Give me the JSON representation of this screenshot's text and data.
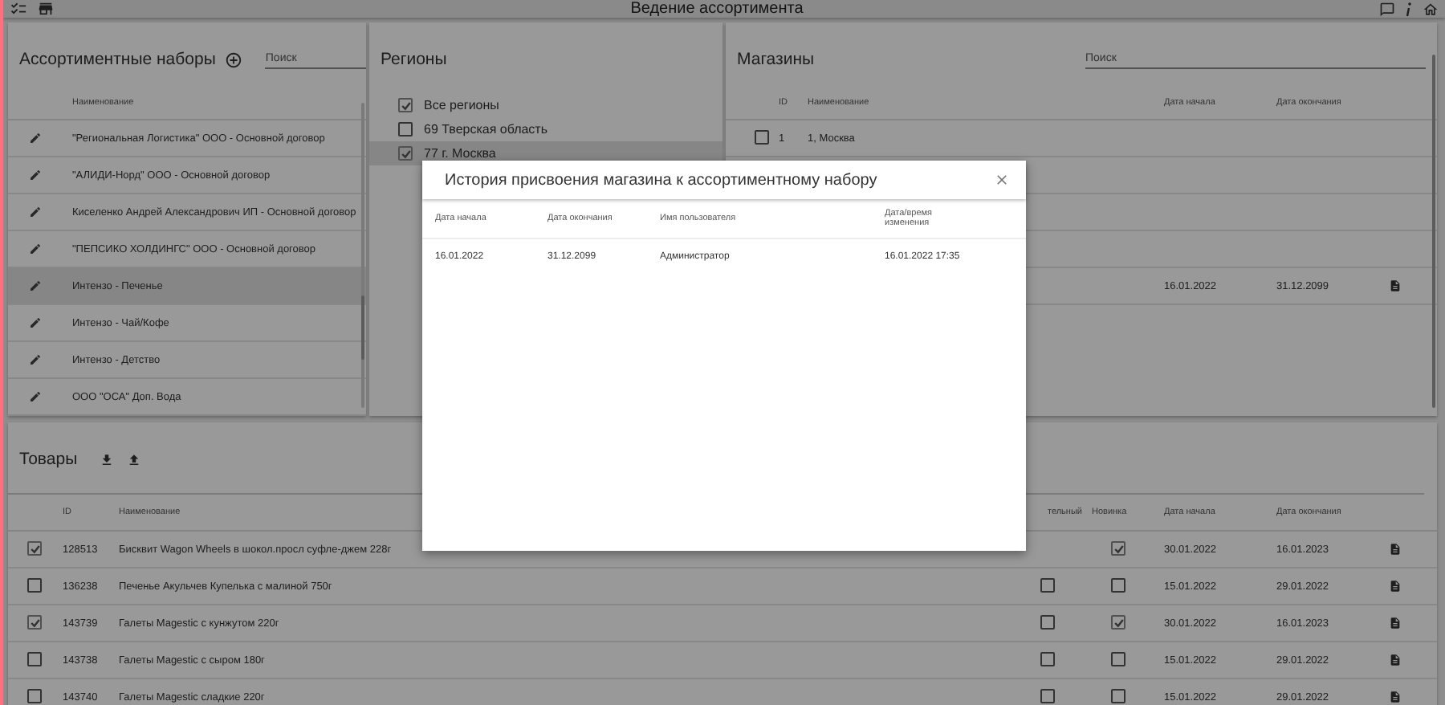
{
  "window": {
    "title": "Ведение ассортимента"
  },
  "assortment_sets": {
    "title": "Ассортиментные наборы",
    "search": {
      "placeholder": "Поиск"
    },
    "columns": [
      "Наименование"
    ],
    "rows": [
      {
        "name": "\"Региональная Логистика\" ООО - Основной договор",
        "selected": false
      },
      {
        "name": "\"АЛИДИ-Норд\" ООО - Основной договор",
        "selected": false
      },
      {
        "name": "Киселенко Андрей Александрович ИП - Основной договор",
        "selected": false
      },
      {
        "name": "\"ПЕПСИКО ХОЛДИНГС\" ООО - Основной договор",
        "selected": false
      },
      {
        "name": "Интензо - Печенье",
        "selected": true
      },
      {
        "name": "Интензо - Чай/Кофе",
        "selected": false
      },
      {
        "name": "Интензо - Детство",
        "selected": false
      },
      {
        "name": "ООО \"ОСА\" Доп. Вода",
        "selected": false
      }
    ]
  },
  "regions": {
    "title": "Регионы",
    "items": [
      {
        "label": "Все регионы",
        "checked": true,
        "selected": false
      },
      {
        "label": "69 Тверская область",
        "checked": false,
        "selected": false
      },
      {
        "label": "77 г. Москва",
        "checked": true,
        "selected": true
      }
    ]
  },
  "stores": {
    "title": "Магазины",
    "search": {
      "placeholder": "Поиск"
    },
    "columns": [
      "ID",
      "Наименование",
      "Дата начала",
      "Дата окончания"
    ],
    "rows": [
      {
        "checked": false,
        "id": "1",
        "name": "1, Москва"
      },
      {},
      {},
      {},
      {
        "start": "16.01.2022",
        "end": "31.12.2099",
        "history": true
      }
    ]
  },
  "goods": {
    "title": "Товары",
    "columns": [
      "ID",
      "Наименование",
      "тельный",
      "Новинка",
      "Дата начала",
      "Дата окончания"
    ],
    "rows": [
      {
        "checked": true,
        "id": "128513",
        "name": "Бисквит Wagon Wheels в шокол.просл суфле-джем 228г",
        "new": true,
        "start": "30.01.2022",
        "end": "16.01.2023"
      },
      {
        "checked": false,
        "id": "136238",
        "name": "Печенье Акульчев Купелька с малиной 750г",
        "flag": false,
        "new": false,
        "start": "15.01.2022",
        "end": "29.01.2022"
      },
      {
        "checked": true,
        "id": "143739",
        "name": "Галеты Magestic с кунжутом 220г",
        "flag": false,
        "new": true,
        "start": "30.01.2022",
        "end": "16.01.2023"
      },
      {
        "checked": false,
        "id": "143738",
        "name": "Галеты Magestic с сыром 180г",
        "flag": false,
        "new": false,
        "start": "15.01.2022",
        "end": "29.01.2022"
      },
      {
        "checked": false,
        "id": "143740",
        "name": "Галеты Magestic сладкие 220г",
        "flag": false,
        "new": false,
        "start": "15.01.2022",
        "end": "29.01.2022"
      }
    ]
  },
  "dialog": {
    "title": "История присвоения магазина к ассортиментному набору",
    "columns": [
      "Дата начала",
      "Дата окончания",
      "Имя пользователя",
      "Дата/время изменения"
    ],
    "rows": [
      [
        "16.01.2022",
        "31.12.2099",
        "Администратор",
        "16.01.2022 17:35"
      ]
    ]
  }
}
